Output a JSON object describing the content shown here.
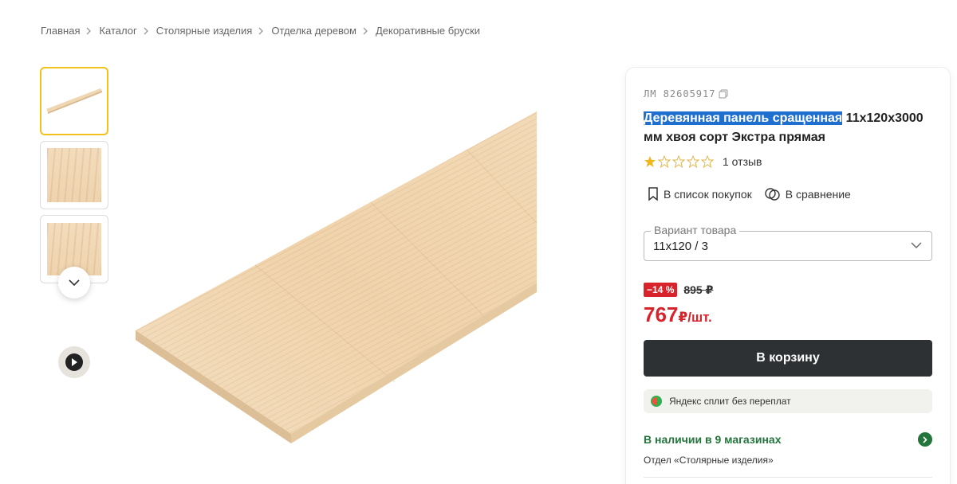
{
  "breadcrumb": [
    {
      "label": "Главная"
    },
    {
      "label": "Каталог"
    },
    {
      "label": "Столярные изделия"
    },
    {
      "label": "Отделка деревом"
    },
    {
      "label": "Декоративные бруски"
    }
  ],
  "product": {
    "sku": "ЛМ 82605917",
    "title_highlighted": "Деревянная панель сращенная",
    "title_rest": " 11х120х3000 мм хвоя сорт Экстра прямая",
    "rating": 1,
    "reviews": "1 отзыв",
    "shopping_list": "В список покупок",
    "compare": "В сравнение",
    "variant_label": "Вариант товара",
    "variant_value": "11x120 / 3",
    "discount_badge": "−14 %",
    "old_price": "895 ₽",
    "price": "767",
    "price_unit": "₽/шт.",
    "cart_button": "В корзину",
    "split_text": "Яндекс сплит без переплат",
    "stock_text": "В наличии в 9 магазинах",
    "department": "Отдел «Столярные изделия»"
  },
  "colors": {
    "accent_red": "#d8232a",
    "cart_button": "#2d3134",
    "stock_green": "#23753c",
    "thumb_active": "#f3c11b",
    "title_highlight": "#1f6fd1"
  }
}
